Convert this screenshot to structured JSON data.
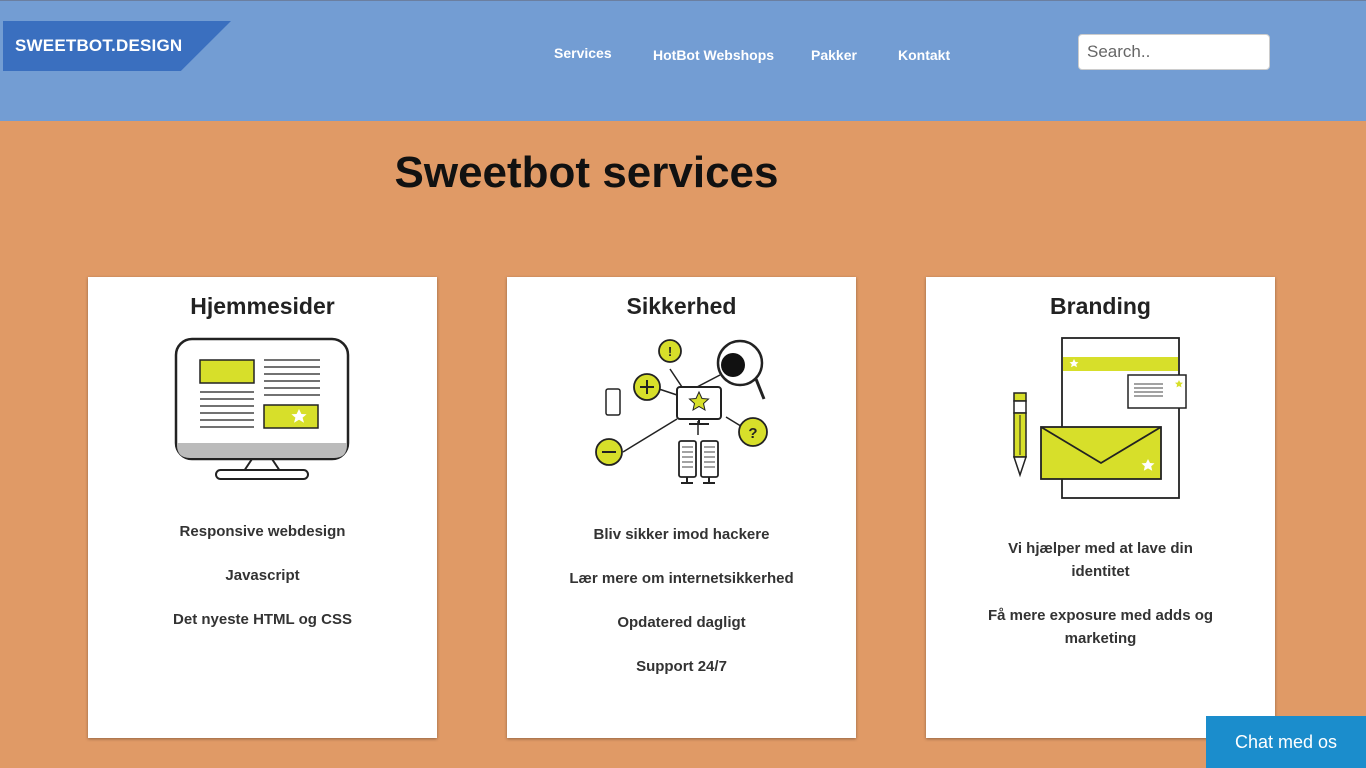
{
  "header": {
    "logo": "SWEETBOT.DESIGN",
    "nav": [
      "Services",
      "HotBot Webshops",
      "Pakker",
      "Kontakt"
    ],
    "search_placeholder": "Search.."
  },
  "main": {
    "title": "Sweetbot services",
    "cards": [
      {
        "title": "Hjemmesider",
        "icon": "monitor-webdesign-icon",
        "items": [
          "Responsive webdesign",
          "Javascript",
          "Det nyeste HTML og CSS"
        ]
      },
      {
        "title": "Sikkerhed",
        "icon": "security-network-icon",
        "items": [
          "Bliv sikker imod hackere",
          "Lær mere om internetsikkerhed",
          "Opdatered dagligt",
          "Support 24/7"
        ]
      },
      {
        "title": "Branding",
        "icon": "branding-stationery-icon",
        "items": [
          "Vi hjælper med at lave din identitet",
          "Få mere exposure med adds og marketing"
        ]
      }
    ]
  },
  "chat": {
    "label": "Chat med os"
  },
  "colors": {
    "header": "#739dd3",
    "logo": "#3a6fbf",
    "background": "#e09a66",
    "accent": "#d7df2a",
    "chat": "#1b8dcc"
  }
}
